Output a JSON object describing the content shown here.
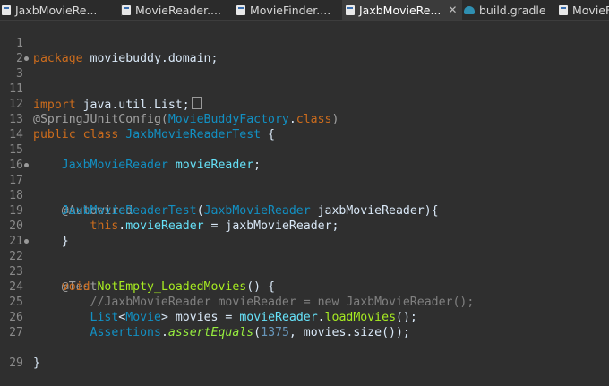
{
  "tabs": [
    {
      "label": "JaxbMovieRe...",
      "icon": "java-file-icon"
    },
    {
      "label": "MovieReader....",
      "icon": "java-file-icon"
    },
    {
      "label": "MovieFinder....",
      "icon": "java-file-icon"
    },
    {
      "label": "JaxbMovieRe...",
      "icon": "java-file-icon",
      "active": true,
      "close": "✕"
    },
    {
      "label": "build.gradle",
      "icon": "gradle-file-icon"
    },
    {
      "label": "MovieF",
      "icon": "java-file-icon"
    }
  ],
  "lines": [
    {
      "n": "1"
    },
    {
      "n": "2"
    },
    {
      "n": "3"
    },
    {
      "n": "11"
    },
    {
      "n": "12"
    },
    {
      "n": "13"
    },
    {
      "n": "14"
    },
    {
      "n": "15"
    },
    {
      "n": "16"
    },
    {
      "n": "17"
    },
    {
      "n": "18"
    },
    {
      "n": "19"
    },
    {
      "n": "20"
    },
    {
      "n": "21"
    },
    {
      "n": "22"
    },
    {
      "n": "23"
    },
    {
      "n": "24"
    },
    {
      "n": "25"
    },
    {
      "n": "26"
    },
    {
      "n": "27"
    },
    {
      "n": "28"
    },
    {
      "n": "29"
    }
  ],
  "code": {
    "l1_kw": "package",
    "l1_rest": " moviebuddy.domain;",
    "l3_kw": "import",
    "l3_rest": " java.util.List;",
    "l12_ann": "@SpringJUnitConfig(",
    "l12_cls": "MovieBuddyFactory",
    "l12_dot": ".",
    "l12_kw": "class",
    "l12_end": ")",
    "l13_kw1": "public",
    "l13_kw2": "class",
    "l13_cls": "JaxbMovieReaderTest",
    "l13_end": " {",
    "l15_cls": "JaxbMovieReader",
    "l15_fld": "movieReader",
    "l15_end": ";",
    "l17_ann": "@Autowired",
    "l18_cls1": "JaxbMovieReaderTest",
    "l18_p": "(",
    "l18_cls2": "JaxbMovieReader",
    "l18_arg": " jaxbMovieReader",
    "l18_end": "){",
    "l19_kw": "this",
    "l19_dot": ".",
    "l19_fld": "movieReader",
    "l19_eq": " = ",
    "l19_val": "jaxbMovieReader",
    "l19_end": ";",
    "l20": "}",
    "l22_ann": "@Test",
    "l23_kw": "void",
    "l23_mth": "NotEmpty_LoadedMovies",
    "l23_end": "() {",
    "l24_cmt": "//JaxbMovieReader movieReader = new JaxbMovieReader();",
    "l25_cls1": "List",
    "l25_lt": "<",
    "l25_cls2": "Movie",
    "l25_gt": ">",
    "l25_var": " movies",
    "l25_eq": " = ",
    "l25_fld": "movieReader",
    "l25_dot": ".",
    "l25_mth": "loadMovies",
    "l25_end": "();",
    "l26_cls": "Assertions",
    "l26_dot": ".",
    "l26_sta": "assertEquals",
    "l26_p": "(",
    "l26_num": "1375",
    "l26_rest": ", movies.size());",
    "l27": "}",
    "l28": "}"
  }
}
